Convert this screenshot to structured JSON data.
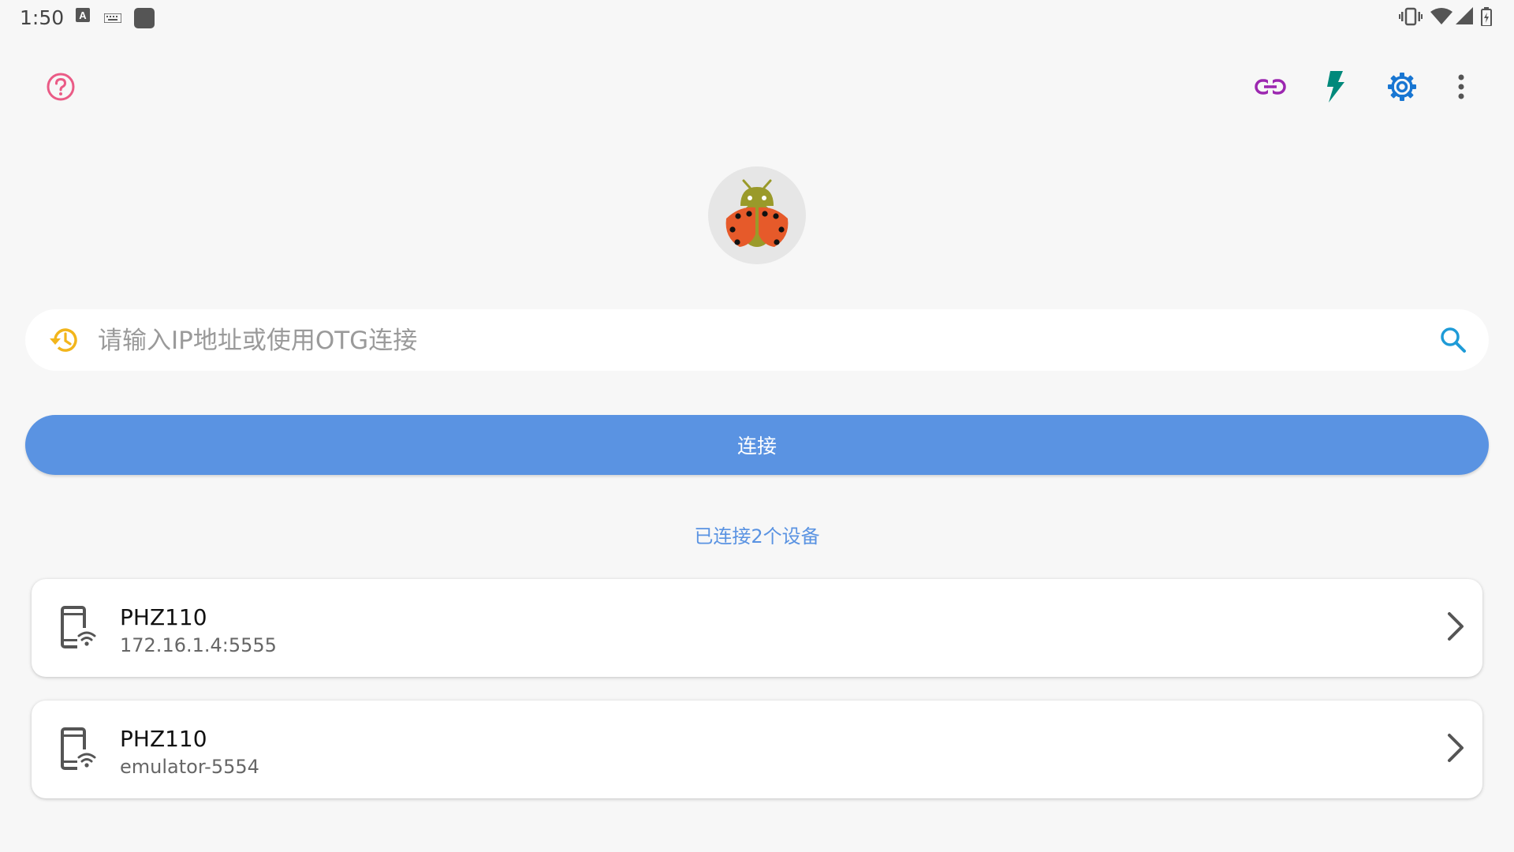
{
  "status_bar": {
    "time": "1:50",
    "left_icons": [
      "a-box-icon",
      "keyboard-icon",
      "app-square-icon"
    ],
    "right_icons": [
      "vibrate-icon",
      "wifi-icon",
      "signal-icon",
      "battery-icon"
    ]
  },
  "toolbar": {
    "help_icon": "help-circle-icon",
    "actions": [
      "link-icon",
      "flash-icon",
      "settings-icon",
      "more-vert-icon"
    ]
  },
  "colors": {
    "background": "#f7f7f7",
    "primary": "#5a93e2",
    "help": "#ea5b86",
    "link": "#9c27b0",
    "flash": "#00897b",
    "settings": "#1976d2",
    "history": "#f2b51b",
    "search": "#1e9bd7"
  },
  "search": {
    "placeholder": "请输入IP地址或使用OTG连接",
    "value": ""
  },
  "connect_button": {
    "label": "连接"
  },
  "connected_count_text": "已连接2个设备",
  "devices": [
    {
      "name": "PHZ110",
      "address": "172.16.1.4:5555"
    },
    {
      "name": "PHZ110",
      "address": "emulator-5554"
    }
  ]
}
